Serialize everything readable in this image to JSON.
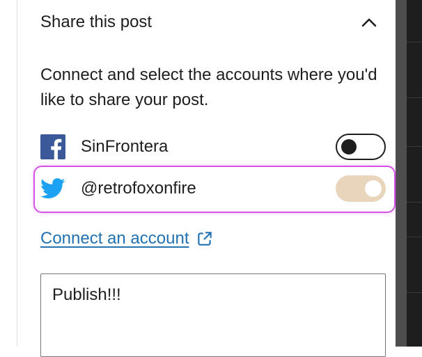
{
  "panel": {
    "title": "Share this post",
    "description": "Connect and select the accounts where you'd like to share your post."
  },
  "accounts": [
    {
      "service": "facebook",
      "icon": "facebook-icon",
      "name": "SinFrontera",
      "enabled": false
    },
    {
      "service": "twitter",
      "icon": "twitter-icon",
      "name": "@retrofoxonfire",
      "enabled": true
    }
  ],
  "connect_link": {
    "label": "Connect an account",
    "icon": "external-link-icon"
  },
  "message": {
    "value": "Publish!!!"
  },
  "colors": {
    "facebook": "#3b5998",
    "twitter": "#1da1f2",
    "link": "#2271b1",
    "toggle_on": "#e8d5bc",
    "highlight": "#d452e6"
  }
}
